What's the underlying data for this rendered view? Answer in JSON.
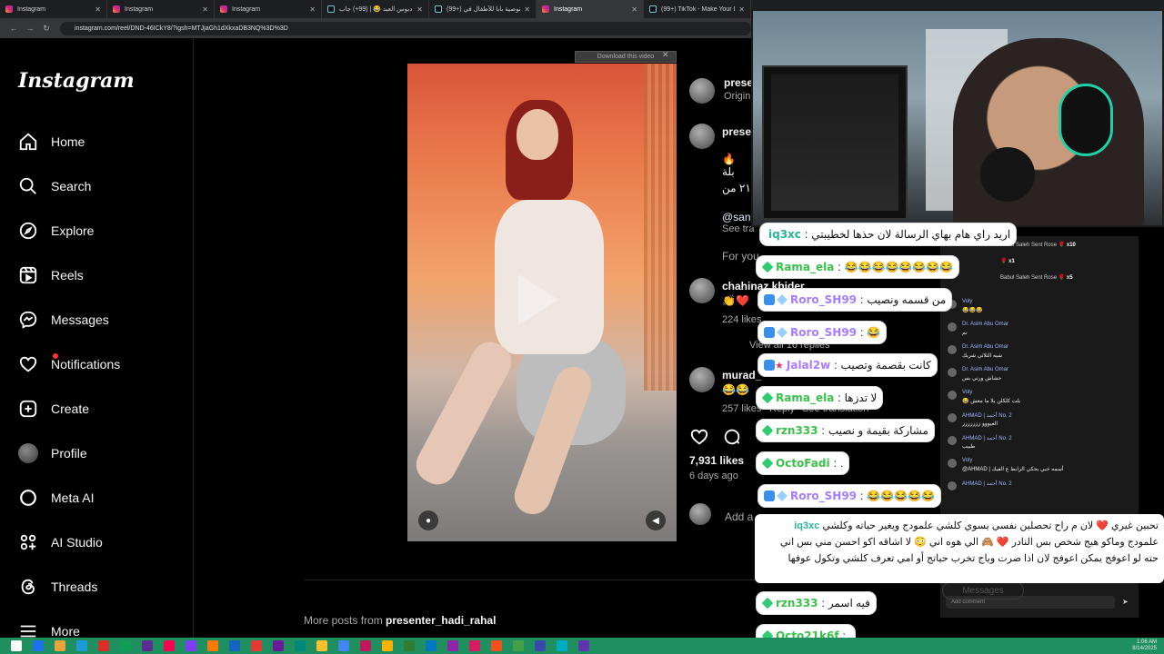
{
  "browser": {
    "tabs": [
      {
        "label": "Instagram",
        "icon": "instagram-icon",
        "active": false
      },
      {
        "label": "Instagram",
        "icon": "instagram-icon",
        "active": false
      },
      {
        "label": "Instagram",
        "icon": "instagram-icon",
        "active": false
      },
      {
        "label": "دبوس العيد 😂 | (99+) جاب",
        "icon": "tiktok-icon",
        "active": false
      },
      {
        "label": "(99+) توصية بابا للأطفال في ...",
        "icon": "tiktok-icon",
        "active": false
      },
      {
        "label": "Instagram",
        "icon": "instagram-icon",
        "active": true
      },
      {
        "label": "(99+) TikTok - Make Your Day",
        "icon": "tiktok-icon",
        "active": false
      }
    ],
    "url": "instagram.com/reel/DND-46ICkY8/?igsh=MTJjaGh1dXkxaDB3NQ%3D%3D"
  },
  "sidebar": {
    "logo": "Instagram",
    "items": [
      {
        "label": "Home",
        "icon": "home-icon"
      },
      {
        "label": "Search",
        "icon": "search-icon"
      },
      {
        "label": "Explore",
        "icon": "compass-icon"
      },
      {
        "label": "Reels",
        "icon": "reels-icon"
      },
      {
        "label": "Messages",
        "icon": "messenger-icon"
      },
      {
        "label": "Notifications",
        "icon": "heart-icon"
      },
      {
        "label": "Create",
        "icon": "plus-square-icon"
      },
      {
        "label": "Profile",
        "icon": "avatar"
      },
      {
        "label": "Meta AI",
        "icon": "meta-ai-icon"
      },
      {
        "label": "AI Studio",
        "icon": "ai-studio-icon"
      },
      {
        "label": "Threads",
        "icon": "threads-icon"
      },
      {
        "label": "More",
        "icon": "menu-icon"
      }
    ]
  },
  "post": {
    "download_label": "Download this video",
    "author_short": "prese",
    "original": "Origin",
    "caption_author": "prese",
    "caption_line1": "🔥",
    "caption_line2": "بلة",
    "caption_line3": "٢١ من",
    "caption_mention": "@san",
    "see_translation_1": "See tra",
    "for_you": "For you",
    "comment1_user": "chahinaz khider",
    "comment1_time": "5 d",
    "comment1_emojis": "👏❤️",
    "comment1_likes": "224 likes",
    "view_replies": "View all 16 replies",
    "comment2_user": "murad_",
    "comment2_emojis": "😂😂",
    "comment2_likes": "257 likes",
    "reply": "Reply",
    "see_translation_2": "See translation",
    "likes": "7,931 likes",
    "time_ago": "6 days ago",
    "add_comment": "Add a",
    "more_posts_prefix": "More posts from",
    "more_posts_user": "presenter_hadi_rahal"
  },
  "stream_chat": [
    {
      "user": "iq3xc",
      "color": "teal",
      "badges": [],
      "msg": "اريد راي هام بهاي الرسالة لان حذها لخطيبتي"
    },
    {
      "user": "Rama_ela",
      "color": "green",
      "badges": [
        "green"
      ],
      "msg": "😂😂😂😂😂😂😂😂"
    },
    {
      "user": "Roro_SH99",
      "color": "purple",
      "badges": [
        "blue",
        "diamond"
      ],
      "msg": "من قسمه ونصيب"
    },
    {
      "user": "Roro_SH99",
      "color": "purple",
      "badges": [
        "blue",
        "diamond"
      ],
      "msg": "😂"
    },
    {
      "user": "Jalal2w",
      "color": "purple",
      "badges": [
        "blue",
        "star"
      ],
      "msg": "كانت بقصمة وتصيب"
    },
    {
      "user": "Rama_ela",
      "color": "green",
      "badges": [
        "green"
      ],
      "msg": "لا تدزها"
    },
    {
      "user": "rzn333",
      "color": "green",
      "badges": [
        "green"
      ],
      "msg": "مشاركة بقيمة و نصيب"
    },
    {
      "user": "OctoFadi",
      "color": "green",
      "badges": [
        "green"
      ],
      "msg": "."
    },
    {
      "user": "Roro_SH99",
      "color": "purple",
      "badges": [
        "blue",
        "diamond"
      ],
      "msg": "😂😂😂😂😂"
    }
  ],
  "big_message": {
    "user": "iq3xc",
    "line1": "تحبين غيري ❤️ لان م راح تحصلين نفسي يسوي كلشي علمودج ويغير حياته وكلشي",
    "line2": "علمودج وماكو هيج شخص بس النادر ❤️ 🙈 الي هوه اني 😳 لا اشاقه اكو احسن مني بس اني",
    "line3": "حته لو اعوفج يمكن اعوفج لان اذا صرت وياج تخرب حياتج أو امي تعرف كلشي وتكول عوفها"
  },
  "bottom_chat": [
    {
      "user": "rzn333",
      "color": "green",
      "msg": "فيه اسمر"
    },
    {
      "user": "Octo21k6f",
      "color": "green",
      "msg": ""
    }
  ],
  "gift_panel": {
    "gifts": [
      {
        "text": "Babul Saleh Sent Rose",
        "count": "x10"
      },
      {
        "text": "",
        "count": "x1"
      },
      {
        "text": "Babul Saleh Sent Rose",
        "count": "x5"
      }
    ],
    "messages": [
      {
        "name": "Voly",
        "msg": "😂😂😂"
      },
      {
        "name": "Dr. Asim Abu Omar",
        "msg": "تم"
      },
      {
        "name": "Dr. Asim Abu Omar",
        "msg": "شيه الثلاثي شريك"
      },
      {
        "name": "Dr. Asim Abu Omar",
        "msg": "حشاش ورني بس"
      },
      {
        "name": "Voly",
        "msg": "😂 بلت كلكلن يلا ما معش"
      },
      {
        "name": "AHMAD | أحمد  No. 2",
        "msg": "العيووو ززززززز"
      },
      {
        "name": "AHMAD | أحمد  No. 2",
        "msg": "طبيب"
      },
      {
        "name": "Voly",
        "msg": "@AHMAD | أسمه خبي يحكي الرابط ع الفيك"
      },
      {
        "name": "AHMAD | أحمد  No. 2",
        "msg": ""
      }
    ],
    "input_placeholder": "Add comment",
    "ghost_label": "Messages"
  },
  "taskbar": {
    "time": "1:06 AM",
    "date": "8/14/2025"
  }
}
